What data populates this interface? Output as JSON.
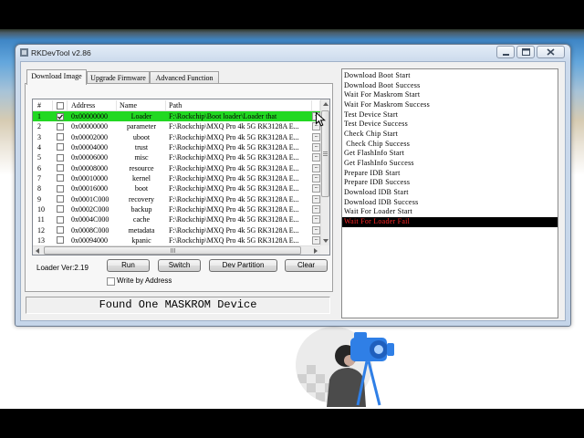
{
  "window": {
    "title": "RKDevTool v2.86"
  },
  "icons": {
    "titlebar": [
      "app-icon",
      "minimize-icon",
      "maximize-icon",
      "close-icon"
    ]
  },
  "tabs": [
    {
      "label": "Download Image",
      "selected": true
    },
    {
      "label": "Upgrade Firmware",
      "selected": false
    },
    {
      "label": "Advanced Function",
      "selected": false
    }
  ],
  "table": {
    "headers": {
      "index": "#",
      "address": "Address",
      "name": "Name",
      "path": "Path"
    },
    "header_checked": false,
    "rows": [
      {
        "index": "1",
        "checked": true,
        "address": "0x00000000",
        "name": "Loader",
        "path": "F:\\Rockchip\\Boot loader\\Loader that",
        "button": "...",
        "highlight": true
      },
      {
        "index": "2",
        "checked": false,
        "address": "0x00000000",
        "name": "parameter",
        "path": "F:\\Rockchip\\MXQ Pro 4k 5G RK3128A E...",
        "button": "..."
      },
      {
        "index": "3",
        "checked": false,
        "address": "0x00002000",
        "name": "uboot",
        "path": "F:\\Rockchip\\MXQ Pro 4k 5G RK3128A E...",
        "button": "..."
      },
      {
        "index": "4",
        "checked": false,
        "address": "0x00004000",
        "name": "trust",
        "path": "F:\\Rockchip\\MXQ Pro 4k 5G RK3128A E...",
        "button": "..."
      },
      {
        "index": "5",
        "checked": false,
        "address": "0x00006000",
        "name": "misc",
        "path": "F:\\Rockchip\\MXQ Pro 4k 5G RK3128A E...",
        "button": "..."
      },
      {
        "index": "6",
        "checked": false,
        "address": "0x00008000",
        "name": "resource",
        "path": "F:\\Rockchip\\MXQ Pro 4k 5G RK3128A E...",
        "button": "..."
      },
      {
        "index": "7",
        "checked": false,
        "address": "0x00010000",
        "name": "kernel",
        "path": "F:\\Rockchip\\MXQ Pro 4k 5G RK3128A E...",
        "button": "..."
      },
      {
        "index": "8",
        "checked": false,
        "address": "0x00016000",
        "name": "boot",
        "path": "F:\\Rockchip\\MXQ Pro 4k 5G RK3128A E...",
        "button": "..."
      },
      {
        "index": "9",
        "checked": false,
        "address": "0x0001C000",
        "name": "recovery",
        "path": "F:\\Rockchip\\MXQ Pro 4k 5G RK3128A E...",
        "button": "..."
      },
      {
        "index": "10",
        "checked": false,
        "address": "0x0002C000",
        "name": "backup",
        "path": "F:\\Rockchip\\MXQ Pro 4k 5G RK3128A E...",
        "button": "..."
      },
      {
        "index": "11",
        "checked": false,
        "address": "0x0004C000",
        "name": "cache",
        "path": "F:\\Rockchip\\MXQ Pro 4k 5G RK3128A E...",
        "button": "..."
      },
      {
        "index": "12",
        "checked": false,
        "address": "0x0008C000",
        "name": "metadata",
        "path": "F:\\Rockchip\\MXQ Pro 4k 5G RK3128A E...",
        "button": "..."
      },
      {
        "index": "13",
        "checked": false,
        "address": "0x00094000",
        "name": "kpanic",
        "path": "F:\\Rockchip\\MXQ Pro 4k 5G RK3128A E...",
        "button": "..."
      }
    ]
  },
  "controls": {
    "loader_version": "Loader Ver:2.19",
    "run": "Run",
    "switch": "Switch",
    "dev_partition": "Dev Partition",
    "clear": "Clear",
    "write_by_address": {
      "label": "Write by Address",
      "checked": false
    }
  },
  "status": "Found One MASKROM Device",
  "log": {
    "lines": [
      "Download Boot Start",
      "Download Boot Success",
      "Wait For Maskrom Start",
      "Wait For Maskrom Success",
      "Test Device Start",
      "Test Device Success",
      "Check Chip Start",
      " Check Chip Success",
      "Get FlashInfo Start",
      "Get FlashInfo Success",
      "Prepare IDB Start",
      "Prepare IDB Success",
      "Download IDB Start",
      "Download IDB Success",
      "Wait For Loader Start",
      "Wait For Loader Fail"
    ],
    "error_line_index": 15
  },
  "colors": {
    "row_highlight": "#22d822",
    "log_error_bg": "#000000",
    "log_error_text": "#ff2626"
  }
}
